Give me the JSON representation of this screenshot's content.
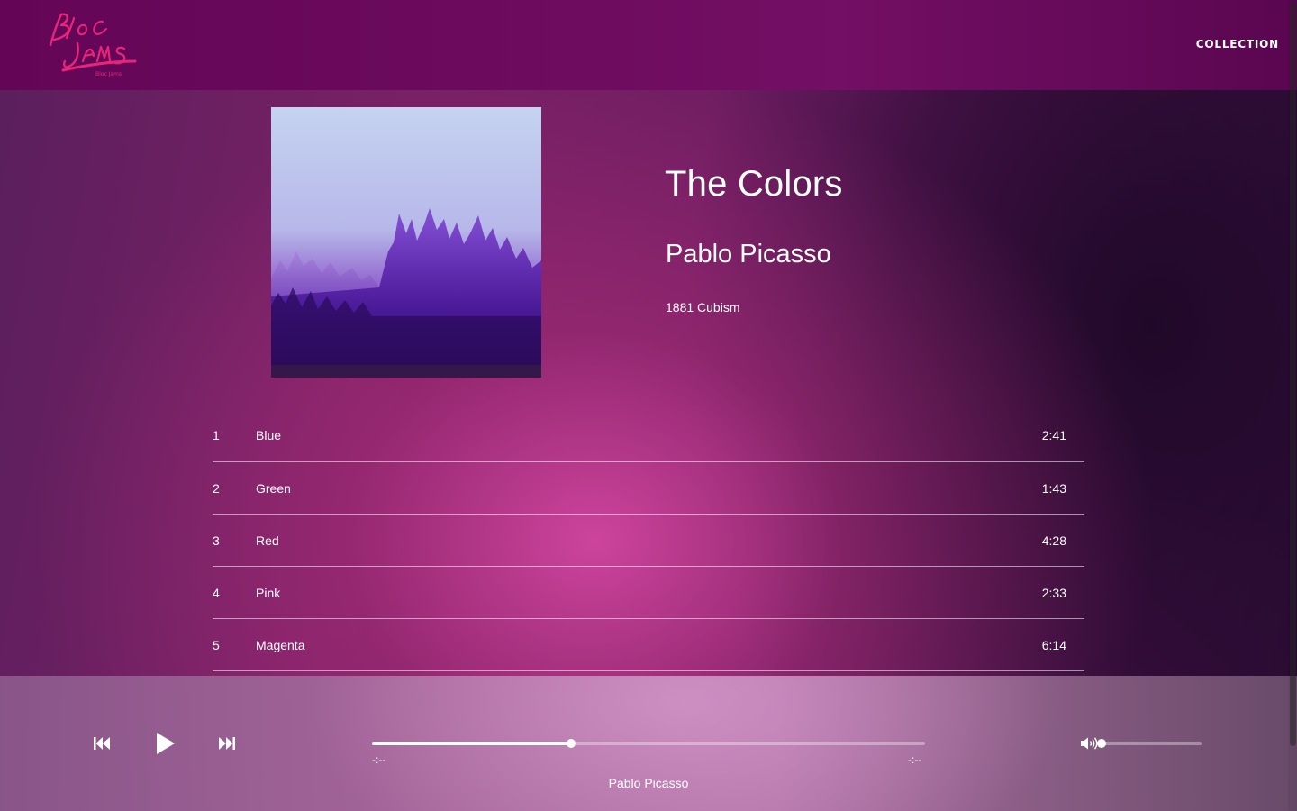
{
  "app": {
    "logo_text": "Bloc Jams",
    "nav": {
      "collection_label": "COLLECTION"
    }
  },
  "album": {
    "title": "The Colors",
    "artist": "Pablo Picasso",
    "release_info": "1881 Cubism",
    "art_colors": [
      "#c8d2ee",
      "#7a3cc0",
      "#2a0e5a"
    ]
  },
  "songs": [
    {
      "number": "1",
      "title": "Blue",
      "duration": "2:41"
    },
    {
      "number": "2",
      "title": "Green",
      "duration": "1:43"
    },
    {
      "number": "3",
      "title": "Red",
      "duration": "4:28"
    },
    {
      "number": "4",
      "title": "Pink",
      "duration": "2:33"
    },
    {
      "number": "5",
      "title": "Magenta",
      "duration": "6:14"
    }
  ],
  "player": {
    "current_time": "-:--",
    "total_time": "-:--",
    "now_playing_artist": "Pablo Picasso",
    "seek_fraction": 0.36,
    "volume_fraction": 0.0,
    "icons": {
      "previous": "skip-previous-icon",
      "play": "play-icon",
      "next": "skip-next-icon",
      "volume": "volume-icon"
    }
  },
  "theme": {
    "header_bg": "#6a0a5c",
    "accent_pink": "#e8257a",
    "text": "#ffffff"
  }
}
